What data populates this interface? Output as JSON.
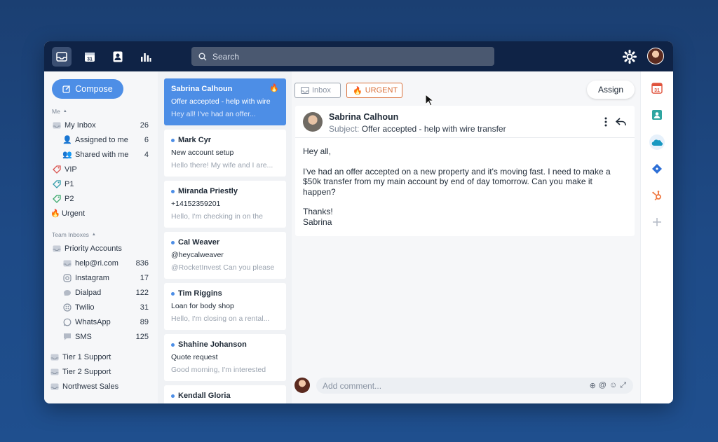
{
  "topbar": {
    "search_placeholder": "Search",
    "nav": [
      "inbox-icon",
      "calendar-icon",
      "contacts-icon",
      "analytics-icon"
    ],
    "calendar_day": "31"
  },
  "sidebar": {
    "compose_label": "Compose",
    "me_label": "Me",
    "me_items": [
      {
        "label": "My Inbox",
        "count": "26",
        "icon": "inbox-icon"
      },
      {
        "label": "Assigned to me",
        "count": "6",
        "icon": "user-icon"
      },
      {
        "label": "Shared with me",
        "count": "4",
        "icon": "users-icon"
      },
      {
        "label": "VIP",
        "icon": "tag-icon",
        "color": "#d9534f"
      },
      {
        "label": "P1",
        "icon": "tag-icon",
        "color": "#2e9aa8"
      },
      {
        "label": "P2",
        "icon": "tag-icon",
        "color": "#3aa86b"
      },
      {
        "label": "Urgent",
        "icon": "flame-icon"
      }
    ],
    "team_label": "Team Inboxes",
    "team_items": [
      {
        "label": "Priority Accounts",
        "icon": "inbox-icon"
      },
      {
        "label": "help@ri.com",
        "count": "836",
        "icon": "inbox-icon"
      },
      {
        "label": "Instagram",
        "count": "17",
        "icon": "instagram-icon"
      },
      {
        "label": "Dialpad",
        "count": "122",
        "icon": "dialpad-icon"
      },
      {
        "label": "Twilio",
        "count": "31",
        "icon": "twilio-icon"
      },
      {
        "label": "WhatsApp",
        "count": "89",
        "icon": "whatsapp-icon"
      },
      {
        "label": "SMS",
        "count": "125",
        "icon": "sms-icon"
      }
    ],
    "other_items": [
      {
        "label": "Tier 1 Support",
        "icon": "inbox-icon"
      },
      {
        "label": "Tier 2 Support",
        "icon": "inbox-icon"
      },
      {
        "label": "Northwest Sales",
        "icon": "inbox-icon"
      }
    ]
  },
  "messages": [
    {
      "from": "Sabrina Calhoun",
      "subject": "Offer accepted - help with wire",
      "preview": "Hey all! I've had an offer...",
      "selected": true,
      "urgent": true
    },
    {
      "from": "Mark Cyr",
      "subject": "New account setup",
      "preview": "Hello there! My wife and I are..."
    },
    {
      "from": "Miranda Priestly",
      "subject": "+14152359201",
      "preview": "Hello, I'm checking in on the"
    },
    {
      "from": "Cal Weaver",
      "subject": "@heycalweaver",
      "preview": "@RocketInvest Can you please"
    },
    {
      "from": "Tim Riggins",
      "subject": "Loan for body shop",
      "preview": "Hello, I'm closing on a rental..."
    },
    {
      "from": "Shahine Johanson",
      "subject": "Quote request",
      "preview": "Good morning, I'm interested"
    },
    {
      "from": "Kendall Gloria",
      "subject": "",
      "preview": ""
    }
  ],
  "conversation": {
    "tag_inbox": "Inbox",
    "tag_urgent": "URGENT",
    "assign_label": "Assign",
    "from": "Sabrina Calhoun",
    "subject_key": "Subject:",
    "subject": "Offer accepted - help with wire transfer",
    "body_greeting": "Hey all,",
    "body_main": "I've had an offer accepted on a new property and it's moving fast. I need to make a $50k transfer from my main account by end of day tomorrow. Can you make it happen?",
    "body_thanks": "Thanks!",
    "body_sign": "Sabrina",
    "comment_placeholder": "Add comment..."
  },
  "rail": {
    "calendar_day": "31",
    "icons": [
      "calendar-icon",
      "contact-card-icon",
      "salesforce-icon",
      "diamond-icon",
      "hubspot-icon",
      "add-integration-icon"
    ]
  },
  "colors": {
    "accent": "#4d8ee6",
    "topbar": "#0f2346",
    "urgent": "#d9703a"
  }
}
